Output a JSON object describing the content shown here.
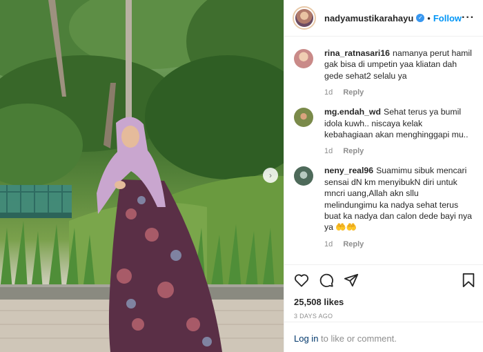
{
  "post": {
    "username": "nadyamustikarahayu",
    "follow_label": "Follow",
    "separator": "•",
    "verified_mark": "✓",
    "more_label": "···",
    "next_arrow": "›"
  },
  "comments": [
    {
      "username": "rina_ratnasari16",
      "text": "namanya perut hamil gak bisa di umpetin yaa kliatan dah gede sehat2 selalu ya",
      "age": "1d",
      "reply": "Reply",
      "avatar_color": "#c98a88"
    },
    {
      "username": "mg.endah_wd",
      "text": "Sehat terus ya bumil idola kuwh.. niscaya kelak kebahagiaan akan menghinggapi mu..",
      "age": "1d",
      "reply": "Reply",
      "avatar_color": "#7a8a4a"
    },
    {
      "username": "neny_real96",
      "text": "Suamimu sibuk mencari sensai dN km menyibukN diri untuk mncri uang,Allah akn sllu melindungimu ka nadya sehat terus buat ka nadya dan calon dede bayi nya ya 🤲🤲",
      "age": "1d",
      "reply": "Reply",
      "avatar_color": "#4e6a5a"
    }
  ],
  "actions": {
    "like_icon": "heart-icon",
    "comment_icon": "comment-icon",
    "share_icon": "share-icon",
    "save_icon": "bookmark-icon"
  },
  "likes": "25,508 likes",
  "posted": "3 DAYS AGO",
  "login": {
    "link": "Log in",
    "rest": " to like or comment."
  },
  "colors": {
    "link_blue": "#0095f6",
    "meta_gray": "#8e8e8e",
    "text": "#262626"
  }
}
